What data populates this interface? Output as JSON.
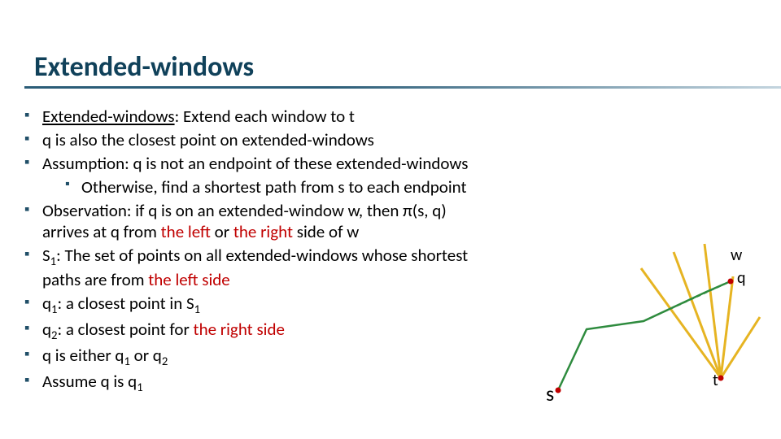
{
  "title": "Extended-windows",
  "bullets": {
    "group1": [
      {
        "prefix": "Extended-windows",
        "rest": ": Extend each window to t",
        "underlinePrefix": true
      },
      {
        "text": "q is also the closest point on extended-windows"
      },
      {
        "text": "Assumption: q is not an endpoint of these extended-windows",
        "sub": [
          {
            "text": "Otherwise, find a shortest path from s to each endpoint"
          }
        ]
      }
    ],
    "observation": {
      "lead": "Observation: if q is on an extended-window w, then π(s, q) arrives at q from ",
      "left_word": "the left",
      "or_word": " or ",
      "right_word": "the right",
      "trail": " side of w"
    },
    "s1": {
      "lead": "S",
      "sub": "1",
      "mid": ": The set of points on all extended-windows whose shortest paths are from ",
      "left_word": "the left side"
    },
    "q1": {
      "lead": "q",
      "sub": "1",
      "mid": ": a closest point in S",
      "sub2": "1"
    },
    "q2": {
      "lead": "q",
      "sub": "2",
      "mid": ": a closest point for ",
      "right_word": "the right side"
    },
    "either": {
      "lead": "q is either q",
      "s1": "1",
      "or": " or q",
      "s2": "2"
    },
    "assume": {
      "lead": "Assume q is q",
      "s1": "1"
    }
  },
  "figure": {
    "s": "s",
    "t": "t",
    "w": "w",
    "q": "q",
    "colors": {
      "window": "#e6b422",
      "path": "#2e8b3e",
      "dot": "#c00000"
    }
  }
}
